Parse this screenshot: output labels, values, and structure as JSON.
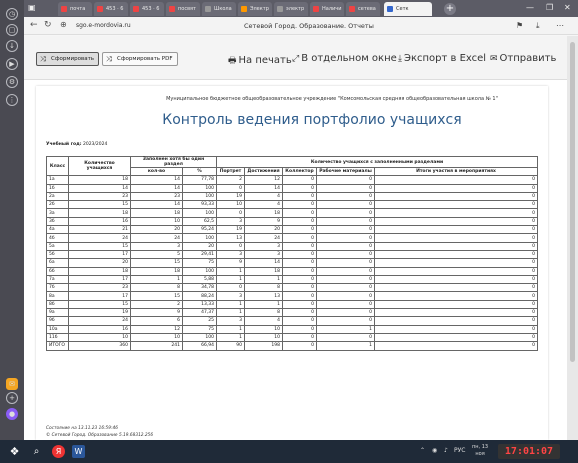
{
  "browser": {
    "tabs": [
      {
        "label": "почта",
        "color": "#e44"
      },
      {
        "label": "453 · 6",
        "color": "#e44"
      },
      {
        "label": "453 · 6",
        "color": "#e44"
      },
      {
        "label": "посвят",
        "color": "#e44"
      },
      {
        "label": "Школа",
        "color": "#999"
      },
      {
        "label": "Электр",
        "color": "#f90"
      },
      {
        "label": "электр",
        "color": "#999"
      },
      {
        "label": "Наличи",
        "color": "#e44"
      },
      {
        "label": "сетева",
        "color": "#e44"
      },
      {
        "label": "Сетк",
        "color": "#36c"
      }
    ],
    "url": "sgo.e-mordovia.ru",
    "page_title": "Сетевой Город. Образование. Отчеты"
  },
  "toolbar": {
    "generate_label": "Сформировать",
    "generate_pdf_label": "Сформировать PDF",
    "print_label": "На печать",
    "separate_window_label": "В отдельном окне",
    "export_excel_label": "Экспорт в Excel",
    "send_label": "Отправить"
  },
  "report": {
    "org": "Муниципальное бюджетное общеобразовательное учреждение \"Комсомольская средняя общеобразовательная школа № 1\"",
    "title": "Контроль ведения портфолио учащихся",
    "year_label": "Учебный год:",
    "year_value": "2023/2024",
    "headers": {
      "class": "Класс",
      "students": "Количество учащихся",
      "filled_group": "Заполнен хотя бы один раздел",
      "count": "кол-во",
      "percent": "%",
      "sections_group": "Количество учащихся с заполненными разделами",
      "portrait": "Портрет",
      "achievements": "Достижения",
      "collector": "Коллектор",
      "work_materials": "Рабочие материалы",
      "events": "Итоги участия в мероприятиях"
    },
    "rows": [
      [
        "1а",
        "18",
        "14",
        "77,78",
        "2",
        "12",
        "0",
        "0",
        "0"
      ],
      [
        "1б",
        "14",
        "14",
        "100",
        "0",
        "14",
        "0",
        "0",
        "0"
      ],
      [
        "2а",
        "23",
        "23",
        "100",
        "19",
        "4",
        "0",
        "0",
        "0"
      ],
      [
        "2б",
        "15",
        "14",
        "93,33",
        "10",
        "4",
        "0",
        "0",
        "0"
      ],
      [
        "3а",
        "18",
        "18",
        "100",
        "0",
        "18",
        "0",
        "0",
        "0"
      ],
      [
        "3б",
        "16",
        "10",
        "62,5",
        "3",
        "9",
        "0",
        "0",
        "0"
      ],
      [
        "4а",
        "21",
        "20",
        "95,24",
        "19",
        "20",
        "0",
        "0",
        "0"
      ],
      [
        "4б",
        "24",
        "24",
        "100",
        "13",
        "24",
        "0",
        "0",
        "0"
      ],
      [
        "5а",
        "15",
        "3",
        "20",
        "0",
        "3",
        "0",
        "0",
        "0"
      ],
      [
        "5б",
        "17",
        "5",
        "29,41",
        "3",
        "3",
        "0",
        "0",
        "0"
      ],
      [
        "6а",
        "20",
        "15",
        "75",
        "9",
        "14",
        "0",
        "0",
        "0"
      ],
      [
        "6б",
        "18",
        "18",
        "100",
        "1",
        "18",
        "0",
        "0",
        "0"
      ],
      [
        "7а",
        "17",
        "1",
        "5,88",
        "1",
        "1",
        "0",
        "0",
        "0"
      ],
      [
        "7б",
        "23",
        "8",
        "34,78",
        "0",
        "8",
        "0",
        "0",
        "0"
      ],
      [
        "8а",
        "17",
        "15",
        "88,24",
        "3",
        "13",
        "0",
        "0",
        "0"
      ],
      [
        "8б",
        "15",
        "2",
        "13,33",
        "1",
        "1",
        "0",
        "0",
        "0"
      ],
      [
        "9а",
        "19",
        "9",
        "47,37",
        "1",
        "8",
        "0",
        "0",
        "0"
      ],
      [
        "9б",
        "24",
        "6",
        "25",
        "3",
        "4",
        "0",
        "0",
        "0"
      ],
      [
        "10а",
        "16",
        "12",
        "75",
        "1",
        "10",
        "0",
        "1",
        "0"
      ],
      [
        "11б",
        "10",
        "10",
        "100",
        "1",
        "10",
        "0",
        "0",
        "0"
      ]
    ],
    "total": [
      "ИТОГО",
      "360",
      "241",
      "66,94",
      "90",
      "198",
      "0",
      "1",
      "0"
    ],
    "footer_state": "Состояние на 13.11.23 16:59:46",
    "footer_copy": "© Сетевой Город. Образование 5.19.68312.256"
  },
  "taskbar": {
    "lang": "РУС",
    "date_line1": "пн, 13",
    "date_line2": "ноя",
    "clock": "17:01:07"
  }
}
